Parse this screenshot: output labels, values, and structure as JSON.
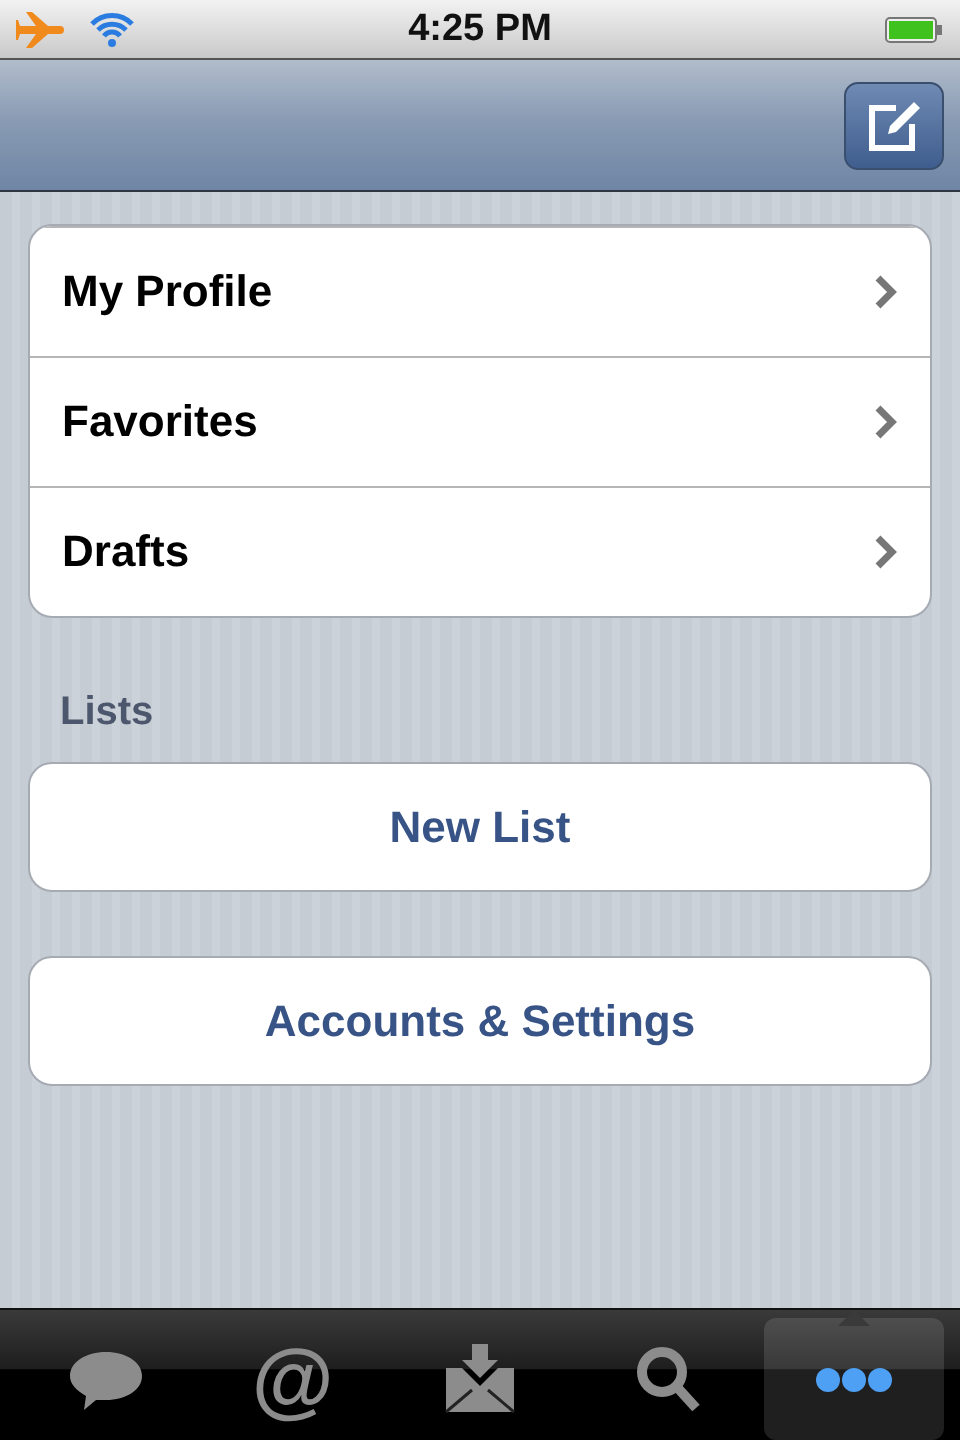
{
  "status_bar": {
    "time": "4:25 PM"
  },
  "menu": [
    {
      "label": "My Profile"
    },
    {
      "label": "Favorites"
    },
    {
      "label": "Drafts"
    }
  ],
  "lists_header": "Lists",
  "buttons": [
    {
      "label": "New List"
    },
    {
      "label": "Accounts & Settings"
    }
  ],
  "tab_bar": [
    {
      "kind": "messages",
      "selected": false
    },
    {
      "kind": "mentions",
      "glyph": "@",
      "selected": false
    },
    {
      "kind": "inbox",
      "selected": false
    },
    {
      "kind": "search",
      "selected": false
    },
    {
      "kind": "more",
      "selected": true
    }
  ]
}
